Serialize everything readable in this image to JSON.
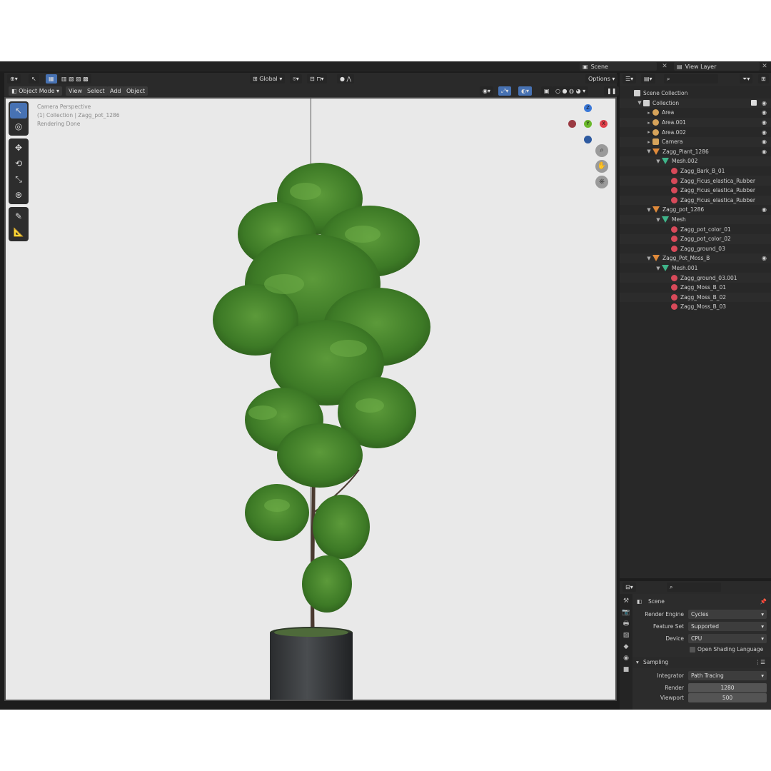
{
  "topbar": {
    "scene": "Scene",
    "view_layer": "View Layer"
  },
  "viewport": {
    "mode": "Object Mode",
    "menus": [
      "View",
      "Select",
      "Add",
      "Object"
    ],
    "transform_orientation": "Global",
    "options": "Options",
    "info_lines": [
      "Camera Perspective",
      "(1) Collection | Zagg_pot_1286",
      "Rendering Done"
    ],
    "axes": {
      "z": "Z",
      "y": "Y",
      "x": "X"
    }
  },
  "outliner": {
    "rows": [
      {
        "label": "Scene Collection",
        "indent": 0,
        "icon": "coll",
        "arrow": ""
      },
      {
        "label": "Collection",
        "indent": 1,
        "icon": "coll",
        "arrow": "▼"
      },
      {
        "label": "Area",
        "indent": 2,
        "icon": "light",
        "arrow": "▸"
      },
      {
        "label": "Area.001",
        "indent": 2,
        "icon": "light",
        "arrow": "▸"
      },
      {
        "label": "Area.002",
        "indent": 2,
        "icon": "light",
        "arrow": "▸"
      },
      {
        "label": "Camera",
        "indent": 2,
        "icon": "cam",
        "arrow": "▸"
      },
      {
        "label": "Zagg_Plant_1286",
        "indent": 2,
        "icon": "obj",
        "arrow": "▼"
      },
      {
        "label": "Mesh.002",
        "indent": 3,
        "icon": "mesh",
        "arrow": "▼"
      },
      {
        "label": "Zagg_Bark_B_01",
        "indent": 4,
        "icon": "mat",
        "arrow": ""
      },
      {
        "label": "Zagg_Ficus_elastica_Rubber",
        "indent": 4,
        "icon": "mat",
        "arrow": ""
      },
      {
        "label": "Zagg_Ficus_elastica_Rubber",
        "indent": 4,
        "icon": "mat",
        "arrow": ""
      },
      {
        "label": "Zagg_Ficus_elastica_Rubber",
        "indent": 4,
        "icon": "mat",
        "arrow": ""
      },
      {
        "label": "Zagg_pot_1286",
        "indent": 2,
        "icon": "obj",
        "arrow": "▼"
      },
      {
        "label": "Mesh",
        "indent": 3,
        "icon": "mesh",
        "arrow": "▼"
      },
      {
        "label": "Zagg_pot_color_01",
        "indent": 4,
        "icon": "mat",
        "arrow": ""
      },
      {
        "label": "Zagg_pot_color_02",
        "indent": 4,
        "icon": "mat",
        "arrow": ""
      },
      {
        "label": "Zagg_ground_03",
        "indent": 4,
        "icon": "mat",
        "arrow": ""
      },
      {
        "label": "Zagg_Pot_Moss_B",
        "indent": 2,
        "icon": "obj",
        "arrow": "▼"
      },
      {
        "label": "Mesh.001",
        "indent": 3,
        "icon": "mesh",
        "arrow": "▼"
      },
      {
        "label": "Zagg_ground_03.001",
        "indent": 4,
        "icon": "mat",
        "arrow": ""
      },
      {
        "label": "Zagg_Moss_B_01",
        "indent": 4,
        "icon": "mat",
        "arrow": ""
      },
      {
        "label": "Zagg_Moss_B_02",
        "indent": 4,
        "icon": "mat",
        "arrow": ""
      },
      {
        "label": "Zagg_Moss_B_03",
        "indent": 4,
        "icon": "mat",
        "arrow": ""
      }
    ]
  },
  "properties": {
    "context": "Scene",
    "render_engine_label": "Render Engine",
    "render_engine": "Cycles",
    "feature_set_label": "Feature Set",
    "feature_set": "Supported",
    "device_label": "Device",
    "device": "CPU",
    "osl_label": "Open Shading Language",
    "sampling_label": "Sampling",
    "integrator_label": "Integrator",
    "integrator": "Path Tracing",
    "render_label": "Render",
    "render_samples": "1280",
    "viewport_label": "Viewport",
    "viewport_samples": "500"
  },
  "colors": {
    "accent": "#4772b3",
    "x_axis": "#e0404a",
    "y_axis": "#6ab82a",
    "z_axis": "#3a78d8"
  }
}
